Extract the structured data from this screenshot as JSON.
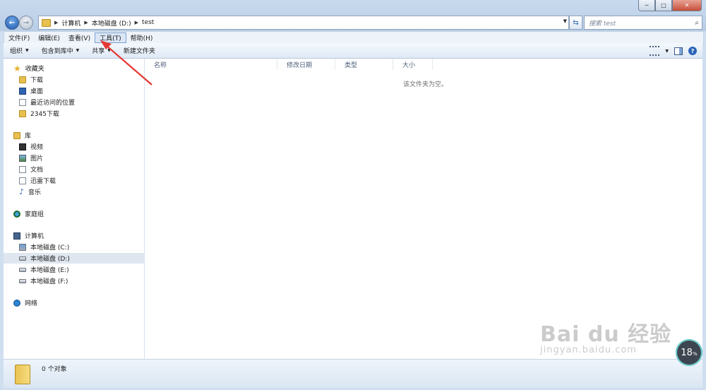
{
  "window": {
    "controls": [
      "─",
      "□",
      "✕"
    ]
  },
  "address": {
    "crumbs": [
      "计算机",
      "本地磁盘 (D:)",
      "test"
    ]
  },
  "search": {
    "placeholder": "搜索 test"
  },
  "menu": [
    "文件(F)",
    "编辑(E)",
    "查看(V)",
    "工具(T)",
    "帮助(H)"
  ],
  "toolbar": {
    "organize": "组织",
    "include_library": "包含到库中",
    "share": "共享",
    "new_folder": "新建文件夹"
  },
  "nav": {
    "favorites": "收藏夹",
    "favorites_items": [
      "下载",
      "桌面",
      "最近访问的位置",
      "2345下载"
    ],
    "libraries": "库",
    "library_items": [
      "视频",
      "图片",
      "文档",
      "迅雷下载",
      "音乐"
    ],
    "homegroup": "家庭组",
    "computer": "计算机",
    "drives": [
      "本地磁盘 (C:)",
      "本地磁盘 (D:)",
      "本地磁盘 (E:)",
      "本地磁盘 (F:)"
    ],
    "network": "网络"
  },
  "columns": [
    "名称",
    "修改日期",
    "类型",
    "大小"
  ],
  "empty_message": "该文件夹为空。",
  "status": {
    "count_text": "0 个对象"
  },
  "watermark": {
    "brand": "Bai du 经验",
    "url": "jingyan.baidu.com"
  },
  "badge": {
    "value": "18",
    "unit": "%"
  },
  "colors": {
    "annotation_arrow": "#e53935",
    "title_bg": "#b9d1ea"
  }
}
